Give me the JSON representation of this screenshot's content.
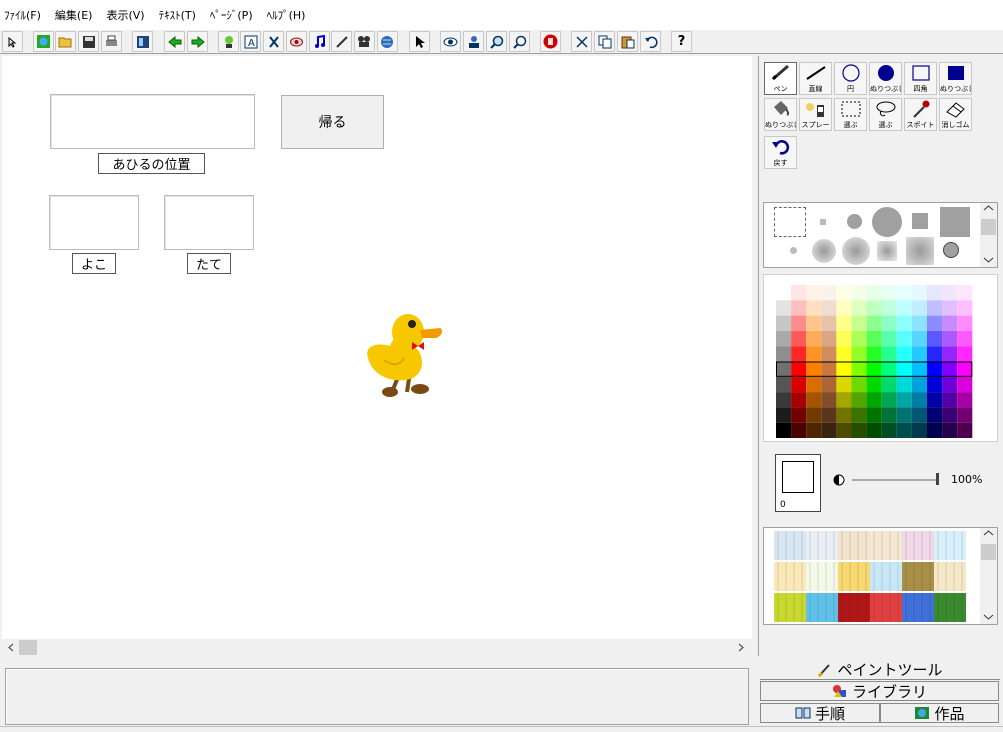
{
  "menu": {
    "items": [
      "ﾌｧｲﾙ(F)",
      "編集(E)",
      "表示(V)",
      "ﾃｷｽﾄ(T)",
      "ﾍﾟｰｼﾞ(P)",
      "ﾍﾙﾌﾟ(H)"
    ]
  },
  "toolbar": {
    "help_label": "?"
  },
  "canvas": {
    "back_button_label": "帰る",
    "position_label": "あひるの位置",
    "x_label": "よこ",
    "y_label": "たて"
  },
  "paint": {
    "tools": [
      {
        "name": "pen",
        "label": "ペン"
      },
      {
        "name": "line",
        "label": "直線"
      },
      {
        "name": "circle",
        "label": "円"
      },
      {
        "name": "circle-fill",
        "label": "ぬりつぶし"
      },
      {
        "name": "rect",
        "label": "四角"
      },
      {
        "name": "rect-fill",
        "label": "ぬりつぶし"
      },
      {
        "name": "bucket",
        "label": "ぬりつぶし"
      },
      {
        "name": "spray",
        "label": "スプレー"
      },
      {
        "name": "select-rect",
        "label": "選ぶ"
      },
      {
        "name": "select-lasso",
        "label": "選ぶ"
      },
      {
        "name": "dropper",
        "label": "スポイト"
      },
      {
        "name": "eraser",
        "label": "消しゴム"
      },
      {
        "name": "undo",
        "label": "戻す"
      }
    ],
    "opacity": "100%",
    "current_color_value": "0"
  },
  "tabs": {
    "paint_tool": "ペイントツール",
    "library": "ライブラリ",
    "procedure": "手順",
    "works": "作品"
  },
  "colors": {
    "palette_hues": [
      "#ff0000",
      "#ff8000",
      "#c87840",
      "#ffff00",
      "#80ff00",
      "#00ff00",
      "#00ff80",
      "#00ffff",
      "#00c0ff",
      "#0000ff",
      "#8000ff",
      "#ff00ff"
    ]
  }
}
